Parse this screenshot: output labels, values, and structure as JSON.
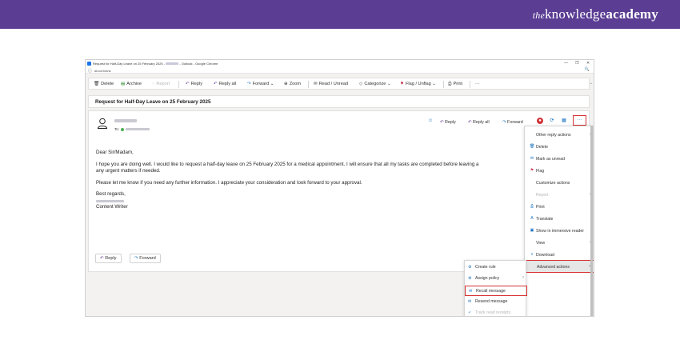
{
  "brand": {
    "the": "the",
    "knowledge": "knowledge",
    "academy": "academy"
  },
  "window": {
    "title": "Request for Half-Day Leave on 25 February 2025 - ",
    "title_suffix": " - Outlook - Google Chrome",
    "minimize": "—",
    "restore": "❐",
    "close": "✕",
    "url": "about:blank",
    "info_icon": "ⓘ",
    "zoom_icon": "🔍"
  },
  "toolbar": {
    "delete": "Delete",
    "archive": "Archive",
    "report": "Report",
    "reply": "Reply",
    "reply_all": "Reply all",
    "forward": "Forward",
    "zoom": "Zoom",
    "read_unread": "Read / Unread",
    "categorize": "Categorize",
    "flag_unflag": "Flag / Unflag",
    "print": "Print",
    "more": "···"
  },
  "subject": "Request for Half-Day Leave on 25 February 2025",
  "message": {
    "to_label": "To:",
    "reply": "Reply",
    "reply_all": "Reply all",
    "forward": "Forward",
    "more": "···",
    "greeting": "Dear Sir/Madam,",
    "paragraph1": "I hope you are doing well. I would like to request a half-day leave on 25 February 2025 for a medical appointment. I will ensure that all my tasks are completed before leaving a",
    "paragraph1b": "any urgent matters if needed.",
    "paragraph2": "Please let me know if you need any further information. I appreciate your consideration and look forward to your approval.",
    "closing": "Best regards,",
    "role": "Content Writer",
    "footer_reply": "Reply",
    "footer_forward": "Forward"
  },
  "more_menu": {
    "items": [
      {
        "label": "Other reply actions",
        "icon": "",
        "chevron": "›"
      },
      {
        "label": "Delete",
        "icon": "🗑",
        "chevron": ""
      },
      {
        "label": "Mark as unread",
        "icon": "✉",
        "chevron": ""
      },
      {
        "label": "Flag",
        "icon": "⚑",
        "chevron": ""
      },
      {
        "label": "Customize actions",
        "icon": "",
        "chevron": ""
      },
      {
        "label": "Report",
        "icon": "",
        "chevron": "›"
      },
      {
        "label": "Print",
        "icon": "⎙",
        "chevron": ""
      },
      {
        "label": "Translate",
        "icon": "A",
        "chevron": ""
      },
      {
        "label": "Show in immersive reader",
        "icon": "▣",
        "chevron": ""
      },
      {
        "label": "View",
        "icon": "",
        "chevron": "›"
      },
      {
        "label": "Download",
        "icon": "⭳",
        "chevron": ""
      },
      {
        "label": "Advanced actions",
        "icon": "",
        "chevron": "›"
      }
    ]
  },
  "advanced_menu": {
    "items": [
      {
        "label": "Create rule",
        "icon": "⚙",
        "chevron": ""
      },
      {
        "label": "Assign policy",
        "icon": "⚙",
        "chevron": "›"
      },
      {
        "label": "Recall message",
        "icon": "✉",
        "chevron": ""
      },
      {
        "label": "Resend message",
        "icon": "✉",
        "chevron": ""
      },
      {
        "label": "Track read receipts",
        "icon": "✓",
        "chevron": ""
      }
    ]
  },
  "colors": {
    "banner": "#5b3d93",
    "accent": "#0f6cbd",
    "highlight_border": "#d63333"
  }
}
